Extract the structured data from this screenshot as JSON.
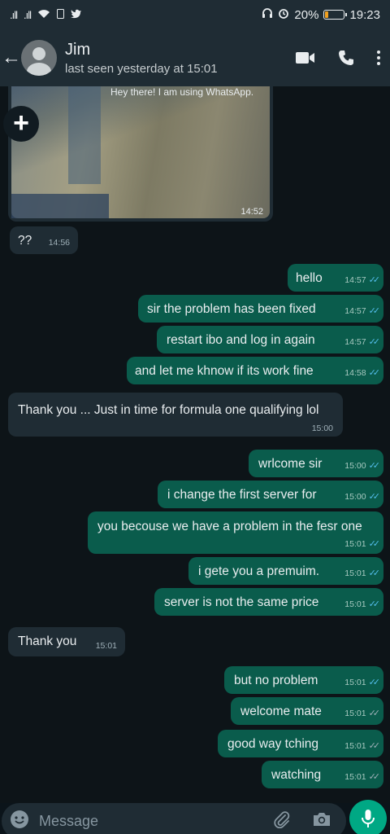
{
  "status_bar": {
    "battery": "20%",
    "time": "19:23",
    "battery_level": 0.2
  },
  "header": {
    "name": "Jim",
    "last_seen": "last seen yesterday at 15:01"
  },
  "image_message": {
    "caption": "Hey there! I am using WhatsApp.",
    "time": "14:52"
  },
  "messages": [
    {
      "dir": "in",
      "text": "??",
      "time": "14:56"
    },
    {
      "dir": "out",
      "text": "hello",
      "time": "14:57",
      "read": true
    },
    {
      "dir": "out",
      "text": "sir the problem has been fixed",
      "time": "14:57",
      "read": true
    },
    {
      "dir": "out",
      "text": "restart ibo and log in again",
      "time": "14:57",
      "read": true
    },
    {
      "dir": "out",
      "text": "and let me khnow if its work fine",
      "time": "14:58",
      "read": true
    },
    {
      "dir": "in",
      "text": "Thank you ... Just in time for formula one qualifying lol",
      "time": "15:00"
    },
    {
      "dir": "out",
      "text": "wrlcome sir",
      "time": "15:00",
      "read": true
    },
    {
      "dir": "out",
      "text": "i change the first server for",
      "time": "15:00",
      "read": true
    },
    {
      "dir": "out",
      "text": "you becouse we have a problem in the fesr one",
      "time": "15:01",
      "read": true
    },
    {
      "dir": "out",
      "text": "i gete you a premuim.",
      "time": "15:01",
      "read": true
    },
    {
      "dir": "out",
      "text": "server is not the same price",
      "time": "15:01",
      "read": true
    },
    {
      "dir": "in",
      "text": "Thank you",
      "time": "15:01"
    },
    {
      "dir": "out",
      "text": "but no problem",
      "time": "15:01",
      "read": true
    },
    {
      "dir": "out",
      "text": "welcome mate",
      "time": "15:01",
      "read": false
    },
    {
      "dir": "out",
      "text": "good way tching",
      "time": "15:01",
      "read": false
    },
    {
      "dir": "out",
      "text": "watching",
      "time": "15:01",
      "read": false
    }
  ],
  "input": {
    "placeholder": "Message"
  },
  "colors": {
    "incoming": "#1f2c34",
    "outgoing": "#0a5c4c",
    "accent": "#00a884",
    "read_tick": "#53bdeb"
  }
}
